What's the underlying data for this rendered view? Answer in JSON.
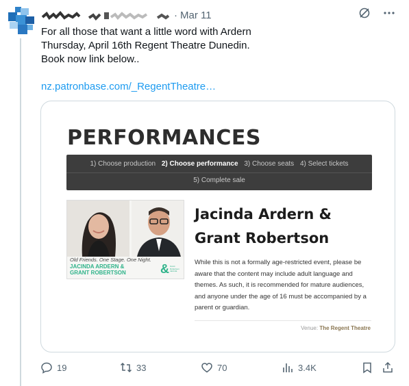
{
  "tweet": {
    "date": "Mar 11",
    "separator": "·",
    "lines": [
      "For all those that want a little word with Ardern",
      "Thursday, April 16th Regent Theatre Dunedin.",
      "Book now link below.."
    ],
    "link": "nz.patronbase.com/_RegentTheatre…"
  },
  "header_icons": [
    "grok-icon",
    "more-icon"
  ],
  "card": {
    "title": "PERFORMANCES",
    "steps": [
      {
        "label": "1) Choose production",
        "active": false
      },
      {
        "label": "2) Choose performance",
        "active": true
      },
      {
        "label": "3) Choose seats",
        "active": false
      },
      {
        "label": "4) Select tickets",
        "active": false
      }
    ],
    "step5": "5) Complete sale",
    "promo": {
      "tagline": "Old Friends. One Stage. One Night.",
      "name1": "JACINDA ARDERN &",
      "name2": "GRANT ROBERTSON",
      "amp": "&",
      "mini": "Grant Robertson Jacinda"
    },
    "event_title_line1": "Jacinda Ardern &",
    "event_title_line2": "Grant Robertson",
    "description": "While this is not a formally age-restricted event, please be aware that the content may include adult language and themes. As such, it is recommended for mature audiences, and anyone under the age of 16 must be accompanied by a parent or guardian.",
    "venue_label": "Venue:",
    "venue_name": "The Regent Theatre"
  },
  "actions": {
    "replies": "19",
    "reposts": "33",
    "likes": "70",
    "views": "3.4K"
  },
  "colors": {
    "link": "#1d9bf0",
    "muted": "#536471",
    "steps_bg": "#3d3d3d",
    "promo_green": "#2fb38a",
    "venue_gold": "#8a7651"
  }
}
